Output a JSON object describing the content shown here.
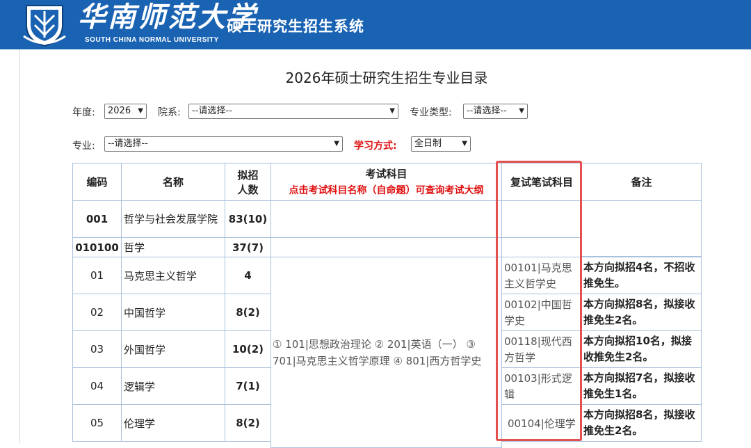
{
  "header": {
    "university_cn": "华南师范大学",
    "university_en": "SOUTH CHINA NORMAL UNIVERSITY",
    "system_name": "硕士研究生招生系统"
  },
  "page_title": "2026年硕士研究生招生专业目录",
  "filters": {
    "year_label": "年度:",
    "year_value": "2026",
    "dept_label": "院系:",
    "dept_value": "--请选择--",
    "type_label": "专业类型:",
    "type_value": "--请选择--",
    "major_label": "专业:",
    "major_value": "--请选择--",
    "mode_label": "学习方式:",
    "mode_value": "全日制"
  },
  "table": {
    "headers": {
      "code": "编码",
      "name": "名称",
      "quota": "拟招人数",
      "subjects": "考试科目",
      "subjects_hint": "点击考试科目名称（自命题）可查询考试大纲",
      "retest": "复试笔试科目",
      "remark": "备注"
    },
    "dept_row": {
      "code": "001",
      "name": "哲学与社会发展学院",
      "quota": "83(10)"
    },
    "major_row": {
      "code": "010100",
      "name": "哲学",
      "quota": "37(7)"
    },
    "exam_subjects": "① 101|思想政治理论 ② 201|英语（一） ③ 701|马克思主义哲学原理 ④ 801|西方哲学史",
    "directions": [
      {
        "code": "01",
        "name": "马克思主义哲学",
        "quota": "4",
        "retest": "00101|马克思主义哲学史",
        "remark": "本方向拟招4名，不招收推免生。"
      },
      {
        "code": "02",
        "name": "中国哲学",
        "quota": "8(2)",
        "retest": "00102|中国哲学史",
        "remark": "本方向拟招8名，拟接收推免生2名。"
      },
      {
        "code": "03",
        "name": "外国哲学",
        "quota": "10(2)",
        "retest": "00118|现代西方哲学",
        "remark": "本方向拟招10名，拟接收推免生2名。"
      },
      {
        "code": "04",
        "name": "逻辑学",
        "quota": "7(1)",
        "retest": "00103|形式逻辑",
        "remark": "本方向拟招7名，拟接收推免生1名。"
      },
      {
        "code": "05",
        "name": "伦理学",
        "quota": "8(2)",
        "retest": "00104|伦理学",
        "remark": "本方向拟招8名，拟接收推免生2名。"
      }
    ]
  },
  "colors": {
    "banner": "#1a63b3",
    "accent_red": "#e01010",
    "highlight_box": "#e4504f",
    "table_border": "#a9c1dc"
  }
}
